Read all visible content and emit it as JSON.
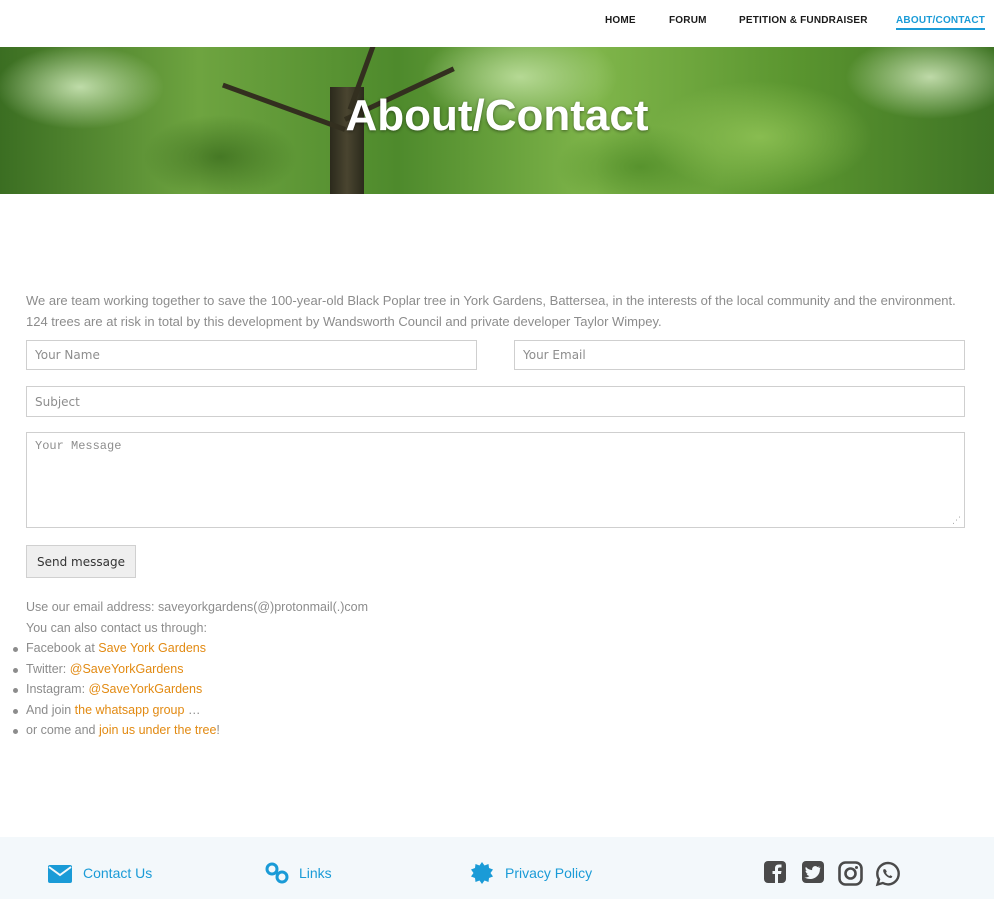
{
  "nav": {
    "items": [
      {
        "label": "HOME"
      },
      {
        "label": "FORUM"
      },
      {
        "label": "PETITION & FUNDRAISER"
      },
      {
        "label": "ABOUT/CONTACT"
      }
    ],
    "active_color": "#1a9bd7"
  },
  "hero": {
    "title": "About/Contact"
  },
  "intro": {
    "text": "We are team working together to save the 100-year-old Black Poplar tree in York Gardens, Battersea, in the interests of the local community and the environment. 124 trees are at risk in total by this development by Wandsworth Council and private developer Taylor Wimpey."
  },
  "form": {
    "name_placeholder": "Your Name",
    "email_placeholder": "Your Email",
    "subject_placeholder": "Subject",
    "message_placeholder": "Your Message",
    "send_label": "Send message"
  },
  "contact": {
    "email_line": "Use our email address: saveyorkgardens(@)protonmail(.)com",
    "also_line": "You can also contact us through:",
    "items": [
      {
        "prefix": "Facebook at ",
        "link": "Save York Gardens",
        "suffix": ""
      },
      {
        "prefix": "Twitter: ",
        "link": "@SaveYorkGardens",
        "suffix": ""
      },
      {
        "prefix": "Instagram: ",
        "link": "@SaveYorkGardens",
        "suffix": ""
      },
      {
        "prefix": "And join ",
        "link": "the whatsapp group",
        "suffix": " …"
      },
      {
        "prefix": "or come and ",
        "link": "join us under the tree",
        "suffix": "!"
      }
    ],
    "link_color": "#e28a12"
  },
  "footer": {
    "contact_label": "Contact Us",
    "links_label": "Links",
    "privacy_label": "Privacy Policy",
    "social_icons": [
      "facebook-icon",
      "twitter-icon",
      "instagram-icon",
      "whatsapp-icon"
    ],
    "accent_color": "#1a9bd7"
  }
}
